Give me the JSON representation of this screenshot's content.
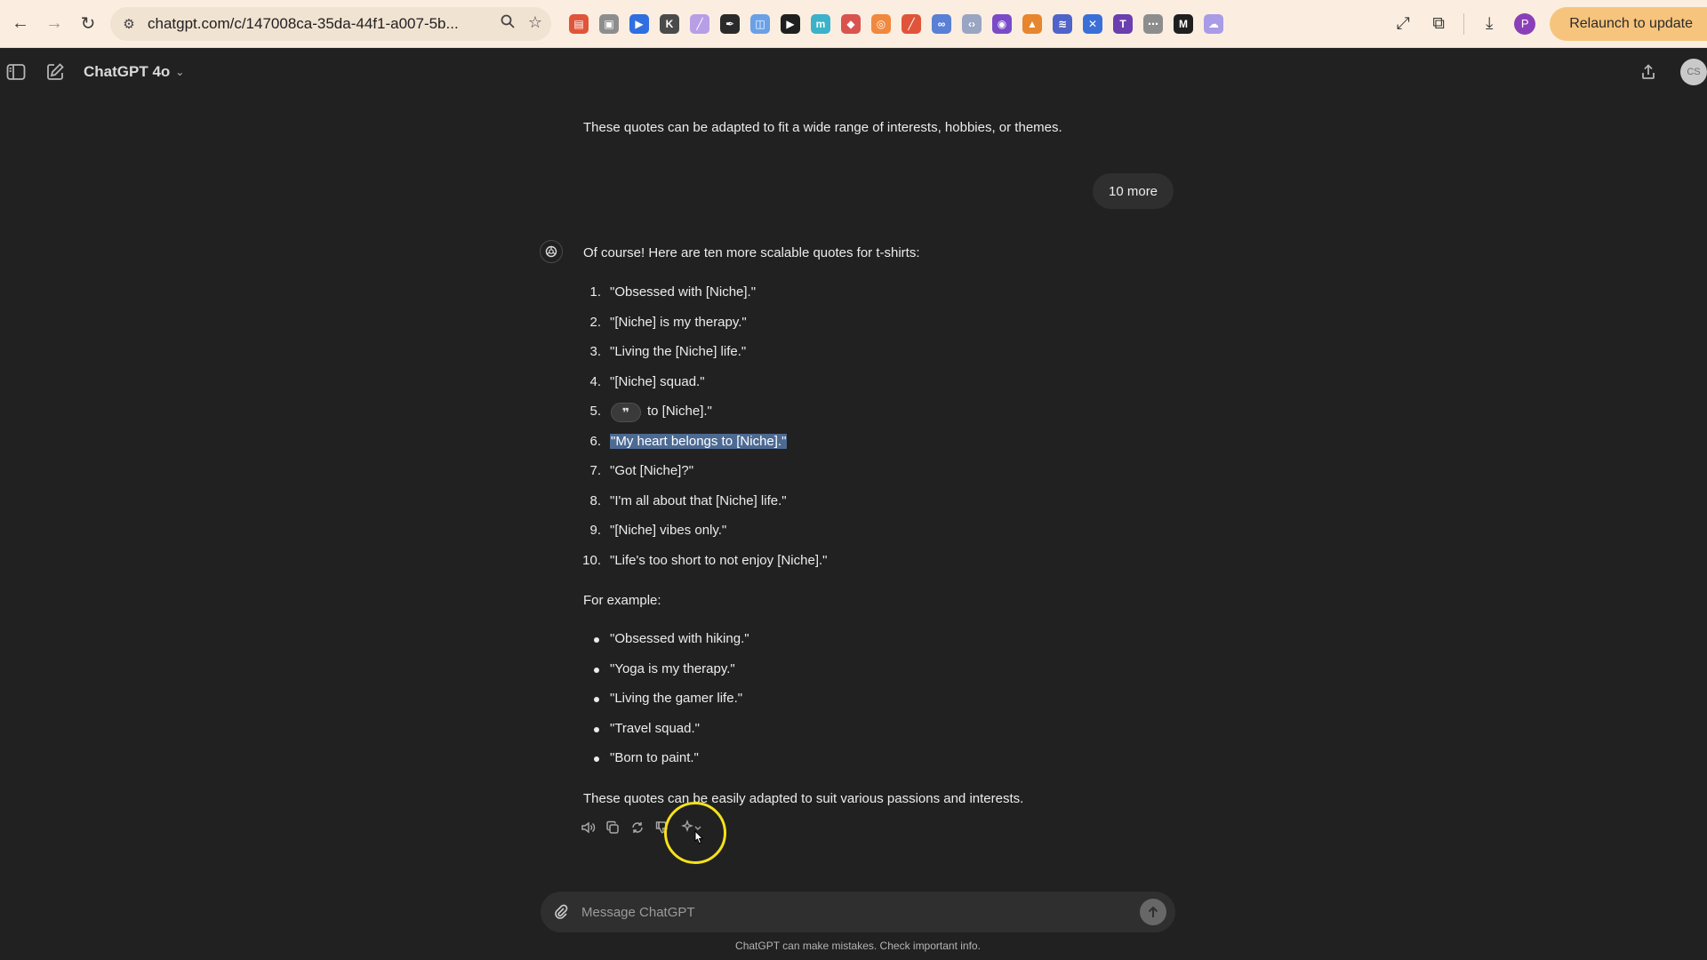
{
  "browser": {
    "url": "chatgpt.com/c/147008ca-35da-44f1-a007-5b...",
    "relaunch_label": "Relaunch to update",
    "profile_initial": "P",
    "extensions": [
      {
        "name": "ext-red-icon",
        "color": "#e0553a",
        "glyph": "▤"
      },
      {
        "name": "ext-gray-icon",
        "color": "#8d8d8d",
        "glyph": "▣"
      },
      {
        "name": "ext-blue-play-icon",
        "color": "#2f6fe0",
        "glyph": "▶"
      },
      {
        "name": "ext-k-icon",
        "color": "#4a4a4a",
        "glyph": "K"
      },
      {
        "name": "ext-pen-icon",
        "color": "#b79ee6",
        "glyph": "╱"
      },
      {
        "name": "ext-eyedropper-icon",
        "color": "#2a2a2a",
        "glyph": "✒"
      },
      {
        "name": "ext-frame-icon",
        "color": "#6aa0e6",
        "glyph": "◫"
      },
      {
        "name": "ext-play-green-icon",
        "color": "#1f1f1f",
        "glyph": "▶"
      },
      {
        "name": "ext-m-icon",
        "color": "#3bb2c9",
        "glyph": "m"
      },
      {
        "name": "ext-color-icon",
        "color": "#d9534f",
        "glyph": "◆"
      },
      {
        "name": "ext-ring-icon",
        "color": "#f0883e",
        "glyph": "◎"
      },
      {
        "name": "ext-brush-icon",
        "color": "#e0553a",
        "glyph": "╱"
      },
      {
        "name": "ext-link-icon",
        "color": "#5a7fd6",
        "glyph": "∞"
      },
      {
        "name": "ext-code-icon",
        "color": "#9aa5c4",
        "glyph": "‹›"
      },
      {
        "name": "ext-eye-icon",
        "color": "#7a4bc9",
        "glyph": "◉"
      },
      {
        "name": "ext-fox-icon",
        "color": "#e6862e",
        "glyph": "▲"
      },
      {
        "name": "ext-chevrons-icon",
        "color": "#4f63c9",
        "glyph": "≋"
      },
      {
        "name": "ext-tool-icon",
        "color": "#3a6fd8",
        "glyph": "✕"
      },
      {
        "name": "ext-t-icon",
        "color": "#6b3fb0",
        "glyph": "T"
      },
      {
        "name": "ext-dots-icon",
        "color": "#8d8d8d",
        "glyph": "⋯"
      },
      {
        "name": "ext-m-bold-icon",
        "color": "#1f1f1f",
        "glyph": "M"
      },
      {
        "name": "ext-cloud-icon",
        "color": "#a99be6",
        "glyph": "☁"
      }
    ]
  },
  "header": {
    "model_name": "ChatGPT 4o",
    "avatar_text": "CS"
  },
  "conversation": {
    "prev_closing": "These quotes can be adapted to fit a wide range of interests, hobbies, or themes.",
    "user_message": "10 more",
    "assistant_intro": "Of course! Here are ten more scalable quotes for t-shirts:",
    "numbered": [
      {
        "num": "1.",
        "text": "\"Obsessed with [Niche].\""
      },
      {
        "num": "2.",
        "text": "\"[Niche] is my therapy.\""
      },
      {
        "num": "3.",
        "text": "\"Living the [Niche] life.\""
      },
      {
        "num": "4.",
        "text": "\"[Niche] squad.\""
      },
      {
        "num": "5.",
        "text": "to [Niche].\""
      },
      {
        "num": "6.",
        "text": "\"My heart belongs to [Niche].\""
      },
      {
        "num": "7.",
        "text": "\"Got [Niche]?\""
      },
      {
        "num": "8.",
        "text": "\"I'm all about that [Niche] life.\""
      },
      {
        "num": "9.",
        "text": "\"[Niche] vibes only.\""
      },
      {
        "num": "10.",
        "text": "\"Life's too short to not enjoy [Niche].\""
      }
    ],
    "example_label": "For example:",
    "examples": [
      "\"Obsessed with hiking.\"",
      "\"Yoga is my therapy.\"",
      "\"Living the gamer life.\"",
      "\"Travel squad.\"",
      "\"Born to paint.\""
    ],
    "closing": "These quotes can be easily adapted to suit various passions and interests.",
    "quote_chip": "❞"
  },
  "composer": {
    "placeholder": "Message ChatGPT",
    "disclaimer": "ChatGPT can make mistakes. Check important info."
  }
}
